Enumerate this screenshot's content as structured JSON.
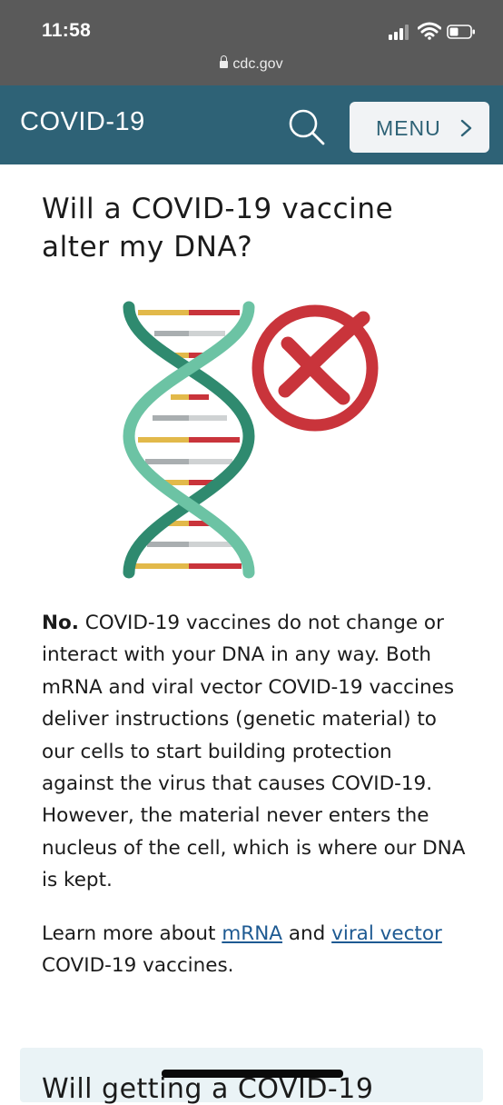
{
  "status_bar": {
    "time": "11:58",
    "url": "cdc.gov",
    "icons": [
      "signal-icon",
      "wifi-icon",
      "battery-icon",
      "lock-icon"
    ]
  },
  "header": {
    "brand": "COVID-19",
    "menu_label": "MENU",
    "icons": [
      "search-icon",
      "chevron-right-icon"
    ],
    "color": "#2e6276"
  },
  "article": {
    "title": "Will a COVID-19 vaccine alter my DNA?",
    "illustration": {
      "icons": [
        "dna-helix-icon",
        "x-mark-icon"
      ],
      "colors": {
        "strand_dark": "#2f8a6f",
        "strand_light": "#6cc3a4",
        "red": "#c9343b",
        "yellow": "#e2b94a",
        "gray": "#a9aeb0"
      }
    },
    "lead_word": "No.",
    "body": " COVID-19 vaccines do not change or interact with your DNA in any way. Both mRNA and viral vector COVID-19 vaccines deliver instructions (genetic material) to our cells to start building protection against the virus that causes COVID-19. However, the material never enters the nucleus of the cell, which is where our DNA is kept.",
    "learn_more": {
      "prefix": "Learn more about ",
      "link1": "mRNA",
      "middle": " and ",
      "link2": "viral vector",
      "suffix": " COVID-19 vaccines."
    }
  },
  "next_section": {
    "title": "Will getting a COVID-19"
  }
}
